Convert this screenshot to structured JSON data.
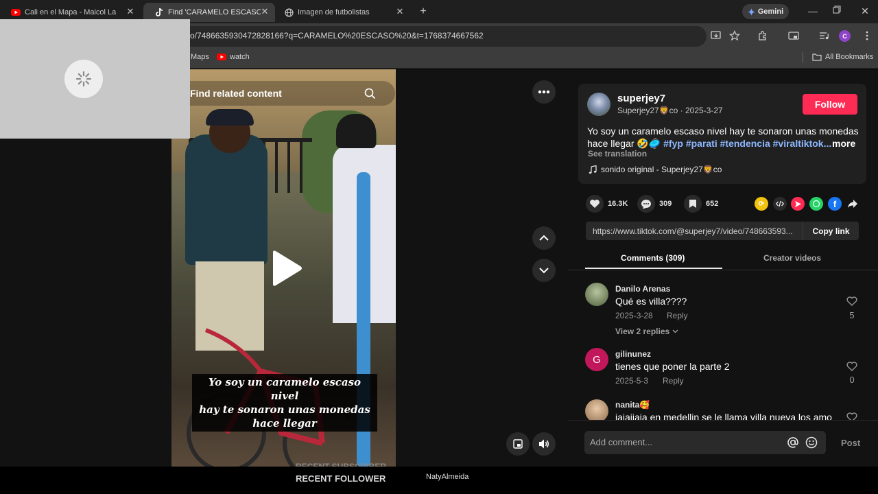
{
  "browser": {
    "tabs": [
      {
        "title": "Cali en el Mapa - Maicol La M",
        "icon": "youtube-icon",
        "active": false
      },
      {
        "title": "Find 'CARAMELO ESCASO ' on T",
        "icon": "tiktok-icon",
        "active": true
      },
      {
        "title": "Imagen de futbolistas",
        "icon": "globe-icon",
        "active": false
      }
    ],
    "new_tab": "+",
    "gemini_label": "Gemini",
    "url": "o/7486635930472828166?q=CARAMELO%20ESCASO%20&t=1768374667562",
    "bookmarks": [
      {
        "label": "Maps",
        "icon": "maps-icon"
      },
      {
        "label": "watch",
        "icon": "youtube-icon"
      }
    ],
    "all_bookmarks": "All Bookmarks",
    "profile_initial": "C"
  },
  "video": {
    "search_placeholder": "Find related content",
    "caption_lines": [
      "Yo soy un caramelo escaso nivel",
      "hay te sonaron unas monedas",
      "hace llegar"
    ]
  },
  "post": {
    "username": "superjey7",
    "nickname_date": "Superjey27🦁co · 2025-3-27",
    "follow_label": "Follow",
    "description": "Yo soy un caramelo escaso nivel hay te sonaron unas monedas hace llegar 🤣🥏",
    "hashtags": "#fyp #parati #tendencia #viraltiktok...",
    "more_label": "more",
    "see_translation": "See translation",
    "sound": "sonido original - Superjey27🦁co",
    "likes": "16.3K",
    "comments": "309",
    "saves": "652",
    "link": "https://www.tiktok.com/@superjey7/video/748663593...",
    "copy_link": "Copy link",
    "tab_comments": "Comments (309)",
    "tab_creator": "Creator videos"
  },
  "comments": [
    {
      "name": "Danilo Arenas",
      "text": "Qué es villa????",
      "date": "2025-3-28",
      "reply": "Reply",
      "likes": "5",
      "view_replies": "View 2 replies"
    },
    {
      "name": "gilinunez",
      "text": "tienes que poner la parte 2",
      "date": "2025-5-3",
      "reply": "Reply",
      "likes": "0",
      "initial": "G"
    },
    {
      "name": "nanita🥰",
      "text": "jajajjaja en medellin se le llama villa nueva los amo"
    }
  ],
  "comment_input": {
    "placeholder": "Add comment...",
    "post": "Post"
  },
  "stream_overlay": {
    "recent_subscriber": "RECENT SUBSCRIBER",
    "recent_follower": "RECENT FOLLOWER",
    "follower_name": "NatyAlmeida"
  },
  "colors": {
    "accent": "#fe2c55",
    "hashtag": "#8db8ff",
    "background": "#121212"
  }
}
